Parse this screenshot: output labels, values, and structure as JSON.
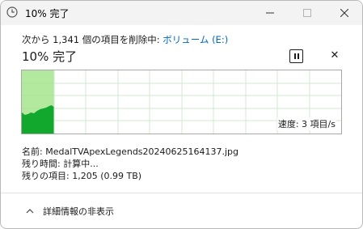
{
  "window": {
    "title": "10% 完了"
  },
  "progress": {
    "status_prefix": "次から 1,341 個の項目を削除中: ",
    "status_link": "ボリューム (E:)",
    "headline": "10% 完了",
    "percent_complete": 10,
    "speed_label": "速度: 3 項目/s"
  },
  "details": {
    "name_label": "名前:",
    "name_value": "MedalTVApexLegends20240625164137.jpg",
    "time_label": "残り時間:",
    "time_value": "計算中...",
    "items_label": "残りの項目:",
    "items_value": "1,205 (0.99 TB)"
  },
  "footer": {
    "toggle_label": "詳細情報の非表示"
  },
  "colors": {
    "progress_fill": "#a6e48e",
    "speed_fill": "#12a82e",
    "grid": "#cfe8cf",
    "link": "#0067c0"
  }
}
